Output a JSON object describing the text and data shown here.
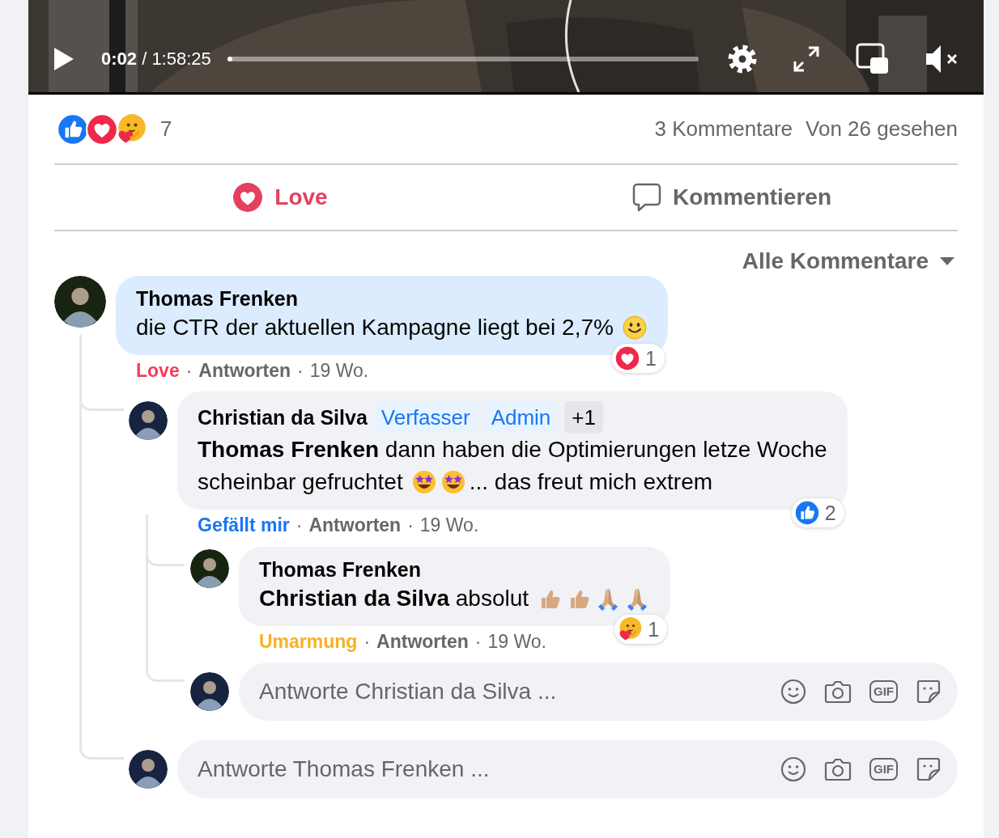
{
  "video": {
    "time": "**0:02** / 1:58:25",
    "progress": {
      "level": 0.01
    }
  },
  "reactions_summary": {
    "icons": [
      {
        "kind": "like"
      },
      {
        "kind": "love"
      },
      {
        "kind": "care"
      }
    ],
    "count": "7"
  },
  "comments_count": "3 Kommentare",
  "views": "Von 26 gesehen",
  "actions": [
    {
      "label": "Love",
      "kind": "love",
      "selected": true
    },
    {
      "label": "Kommentieren",
      "kind": "comment",
      "selected": false
    }
  ],
  "filter": {
    "label": "Alle Kommentare"
  },
  "comments": [
    {
      "author": "Thomas Frenken",
      "avatar": {
        "color": "#18240f"
      },
      "highlighted": true,
      "body_lines": [
        {
          "parts": [
            {
              "kind": "text",
              "text": "die CTR der aktuellen Kampagne liegt bei 2,7%"
            },
            {
              "kind": "smiley"
            }
          ]
        }
      ],
      "reaction": {
        "label": "Love",
        "kind": "love"
      },
      "separator": "·",
      "reply_label": "Antworten",
      "separator_2": "·",
      "time": "19 Wo.",
      "reaction_badge": {
        "kind": "love",
        "count": "1"
      },
      "replies": [
        {
          "author": "Christian da Silva",
          "avatar": {
            "color": "#162440"
          },
          "highlighted": false,
          "badges": [
            {
              "label": "Verfasser",
              "kind": "role"
            },
            {
              "label": "Admin",
              "kind": "role"
            },
            {
              "label": "+1",
              "kind": "more"
            }
          ],
          "body_lines": [
            {
              "parts": [
                {
                  "kind": "text",
                  "text": "**Thomas Frenken** dann haben die Optimierungen letze Woche"
                }
              ]
            },
            {
              "parts": [
                {
                  "kind": "text",
                  "text": "scheinbar gefruchtet"
                },
                {
                  "kind": "star-struck"
                },
                {
                  "kind": "star-struck"
                },
                {
                  "kind": "text",
                  "text": "... das freut mich extrem"
                }
              ]
            }
          ],
          "reaction": {
            "label": "Gefällt mir",
            "kind": "like"
          },
          "separator": "·",
          "reply_label": "Antworten",
          "separator_2": "·",
          "time": "19 Wo.",
          "reaction_badge": {
            "kind": "like",
            "count": "2"
          },
          "replies": [
            {
              "author": "Thomas Frenken",
              "avatar": {
                "color": "#18240f"
              },
              "highlighted": false,
              "body_lines": [
                {
                  "parts": [
                    {
                      "kind": "text",
                      "text": "**Christian da Silva** absolut"
                    },
                    {
                      "kind": "thumbs-up"
                    },
                    {
                      "kind": "thumbs-up"
                    },
                    {
                      "kind": "praying"
                    },
                    {
                      "kind": "praying"
                    }
                  ]
                }
              ],
              "reaction": {
                "label": "Umarmung",
                "kind": "care"
              },
              "separator": "·",
              "reply_label": "Antworten",
              "separator_2": "·",
              "time": "19 Wo.",
              "reaction_badge": {
                "kind": "care",
                "count": "1"
              }
            }
          ],
          "reply_field": {
            "placeholder": "Antworte Christian da Silva ...",
            "gif_label": "GIF",
            "avatar": {
              "color": "#162440"
            }
          }
        }
      ],
      "reply_field": {
        "placeholder": "Antworte Thomas Frenken ...",
        "gif_label": "GIF",
        "avatar": {
          "color": "#162440"
        }
      }
    }
  ]
}
